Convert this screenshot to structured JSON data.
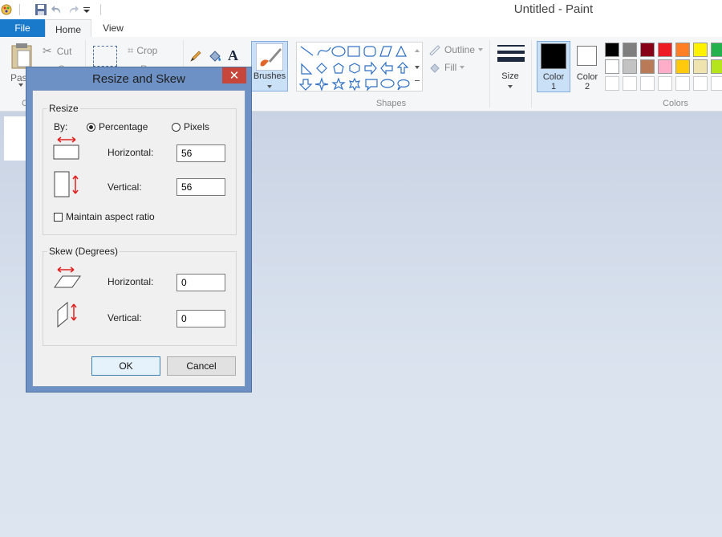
{
  "window": {
    "title": "Untitled - Paint"
  },
  "tabs": {
    "file": "File",
    "home": "Home",
    "view": "View"
  },
  "clipboard": {
    "paste": "Past",
    "cut": "Cut",
    "copy": "C",
    "group_label_fragment": "C"
  },
  "image": {
    "crop": "Crop",
    "resize": "R"
  },
  "brushes": {
    "label": "Brushes"
  },
  "shapes": {
    "outline": "Outline",
    "fill": "Fill",
    "group_label": "Shapes"
  },
  "size": {
    "label": "Size"
  },
  "color1": {
    "label_line1": "Color",
    "label_line2": "1"
  },
  "color2": {
    "label_line1": "Color",
    "label_line2": "2"
  },
  "colors": {
    "group_label": "Colors",
    "row1": [
      "#000000",
      "#7f7f7f",
      "#880015",
      "#ed1c24",
      "#ff7f27",
      "#fff200",
      "#22b14c"
    ],
    "row2": [
      "#ffffff",
      "#c3c3c3",
      "#b97a57",
      "#ffaec9",
      "#ffc90e",
      "#efe4b0",
      "#b5e61d"
    ],
    "row3": [
      "#ffffff",
      "#ffffff",
      "#ffffff",
      "#ffffff",
      "#ffffff",
      "#ffffff",
      "#ffffff"
    ]
  },
  "dialog": {
    "title": "Resize and Skew",
    "close": "✕",
    "resize": {
      "legend": "Resize",
      "by_label": "By:",
      "percentage_label": "Percentage",
      "pixels_label": "Pixels",
      "selected": "percentage",
      "horizontal_label": "Horizontal:",
      "horizontal_value": "56",
      "vertical_label": "Vertical:",
      "vertical_value": "56",
      "maintain_label": "Maintain aspect ratio",
      "maintain_checked": false
    },
    "skew": {
      "legend": "Skew (Degrees)",
      "horizontal_label": "Horizontal:",
      "horizontal_value": "0",
      "vertical_label": "Vertical:",
      "vertical_value": "0"
    },
    "ok": "OK",
    "cancel": "Cancel"
  }
}
